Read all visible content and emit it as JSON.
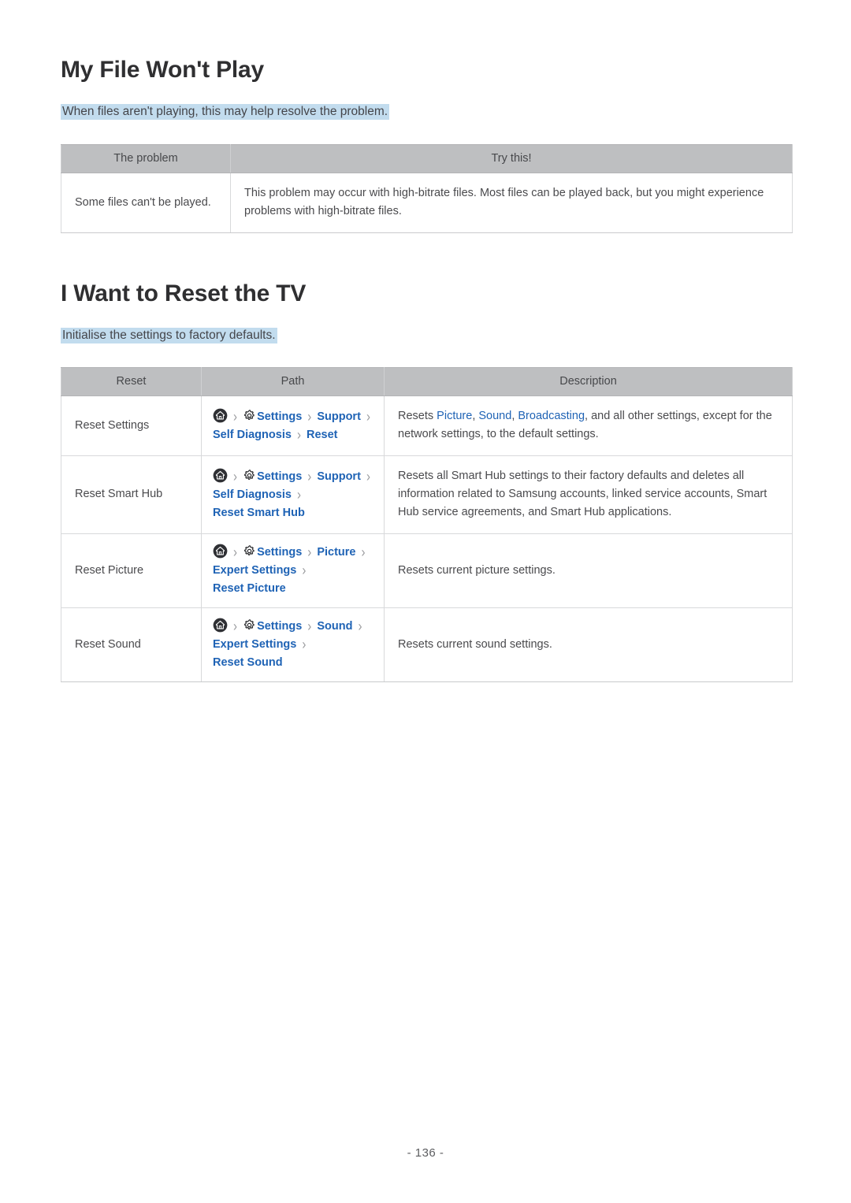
{
  "page": {
    "number_label": "- 136 -",
    "accent_blue": "#1f63b5",
    "highlight_blue": "#c2dcee",
    "header_gray": "#bebfc1"
  },
  "sections": [
    {
      "title": "My File Won't Play",
      "lead": "When files aren't playing, this may help resolve the problem.",
      "table": {
        "headers": [
          "The problem",
          "Try this!"
        ],
        "rows": [
          {
            "problem": "Some files can't be played.",
            "try_this": "This problem may occur with high-bitrate files. Most files can be played back, but you might experience problems with high-bitrate files."
          }
        ]
      }
    },
    {
      "title": "I Want to Reset the TV",
      "lead": "Initialise the settings to factory defaults.",
      "table": {
        "headers": [
          "Reset",
          "Path",
          "Description"
        ],
        "rows": [
          {
            "reset": "Reset Settings",
            "path_icons": [
              "home-icon",
              "gear-icon"
            ],
            "path_segments": [
              "Settings",
              "Support",
              "Self Diagnosis",
              "Reset"
            ],
            "description_prefix": "Resets ",
            "description_links": [
              "Picture",
              "Sound",
              "Broadcasting"
            ],
            "description_suffix": ", and all other settings, except for the network settings, to the default settings.",
            "description_full": "Resets Picture, Sound, Broadcasting, and all other settings, except for the network settings, to the default settings."
          },
          {
            "reset": "Reset Smart Hub",
            "path_icons": [
              "home-icon",
              "gear-icon"
            ],
            "path_segments": [
              "Settings",
              "Support",
              "Self Diagnosis",
              "Reset Smart Hub"
            ],
            "description_full": "Resets all Smart Hub settings to their factory defaults and deletes all information related to Samsung accounts, linked service accounts, Smart Hub service agreements, and Smart Hub applications."
          },
          {
            "reset": "Reset Picture",
            "path_icons": [
              "home-icon",
              "gear-icon"
            ],
            "path_segments": [
              "Settings",
              "Picture",
              "Expert Settings",
              "Reset Picture"
            ],
            "description_full": "Resets current picture settings."
          },
          {
            "reset": "Reset Sound",
            "path_icons": [
              "home-icon",
              "gear-icon"
            ],
            "path_segments": [
              "Settings",
              "Sound",
              "Expert Settings",
              "Reset Sound"
            ],
            "description_full": "Resets current sound settings."
          }
        ]
      }
    }
  ],
  "icons": {
    "chevron": "›"
  }
}
